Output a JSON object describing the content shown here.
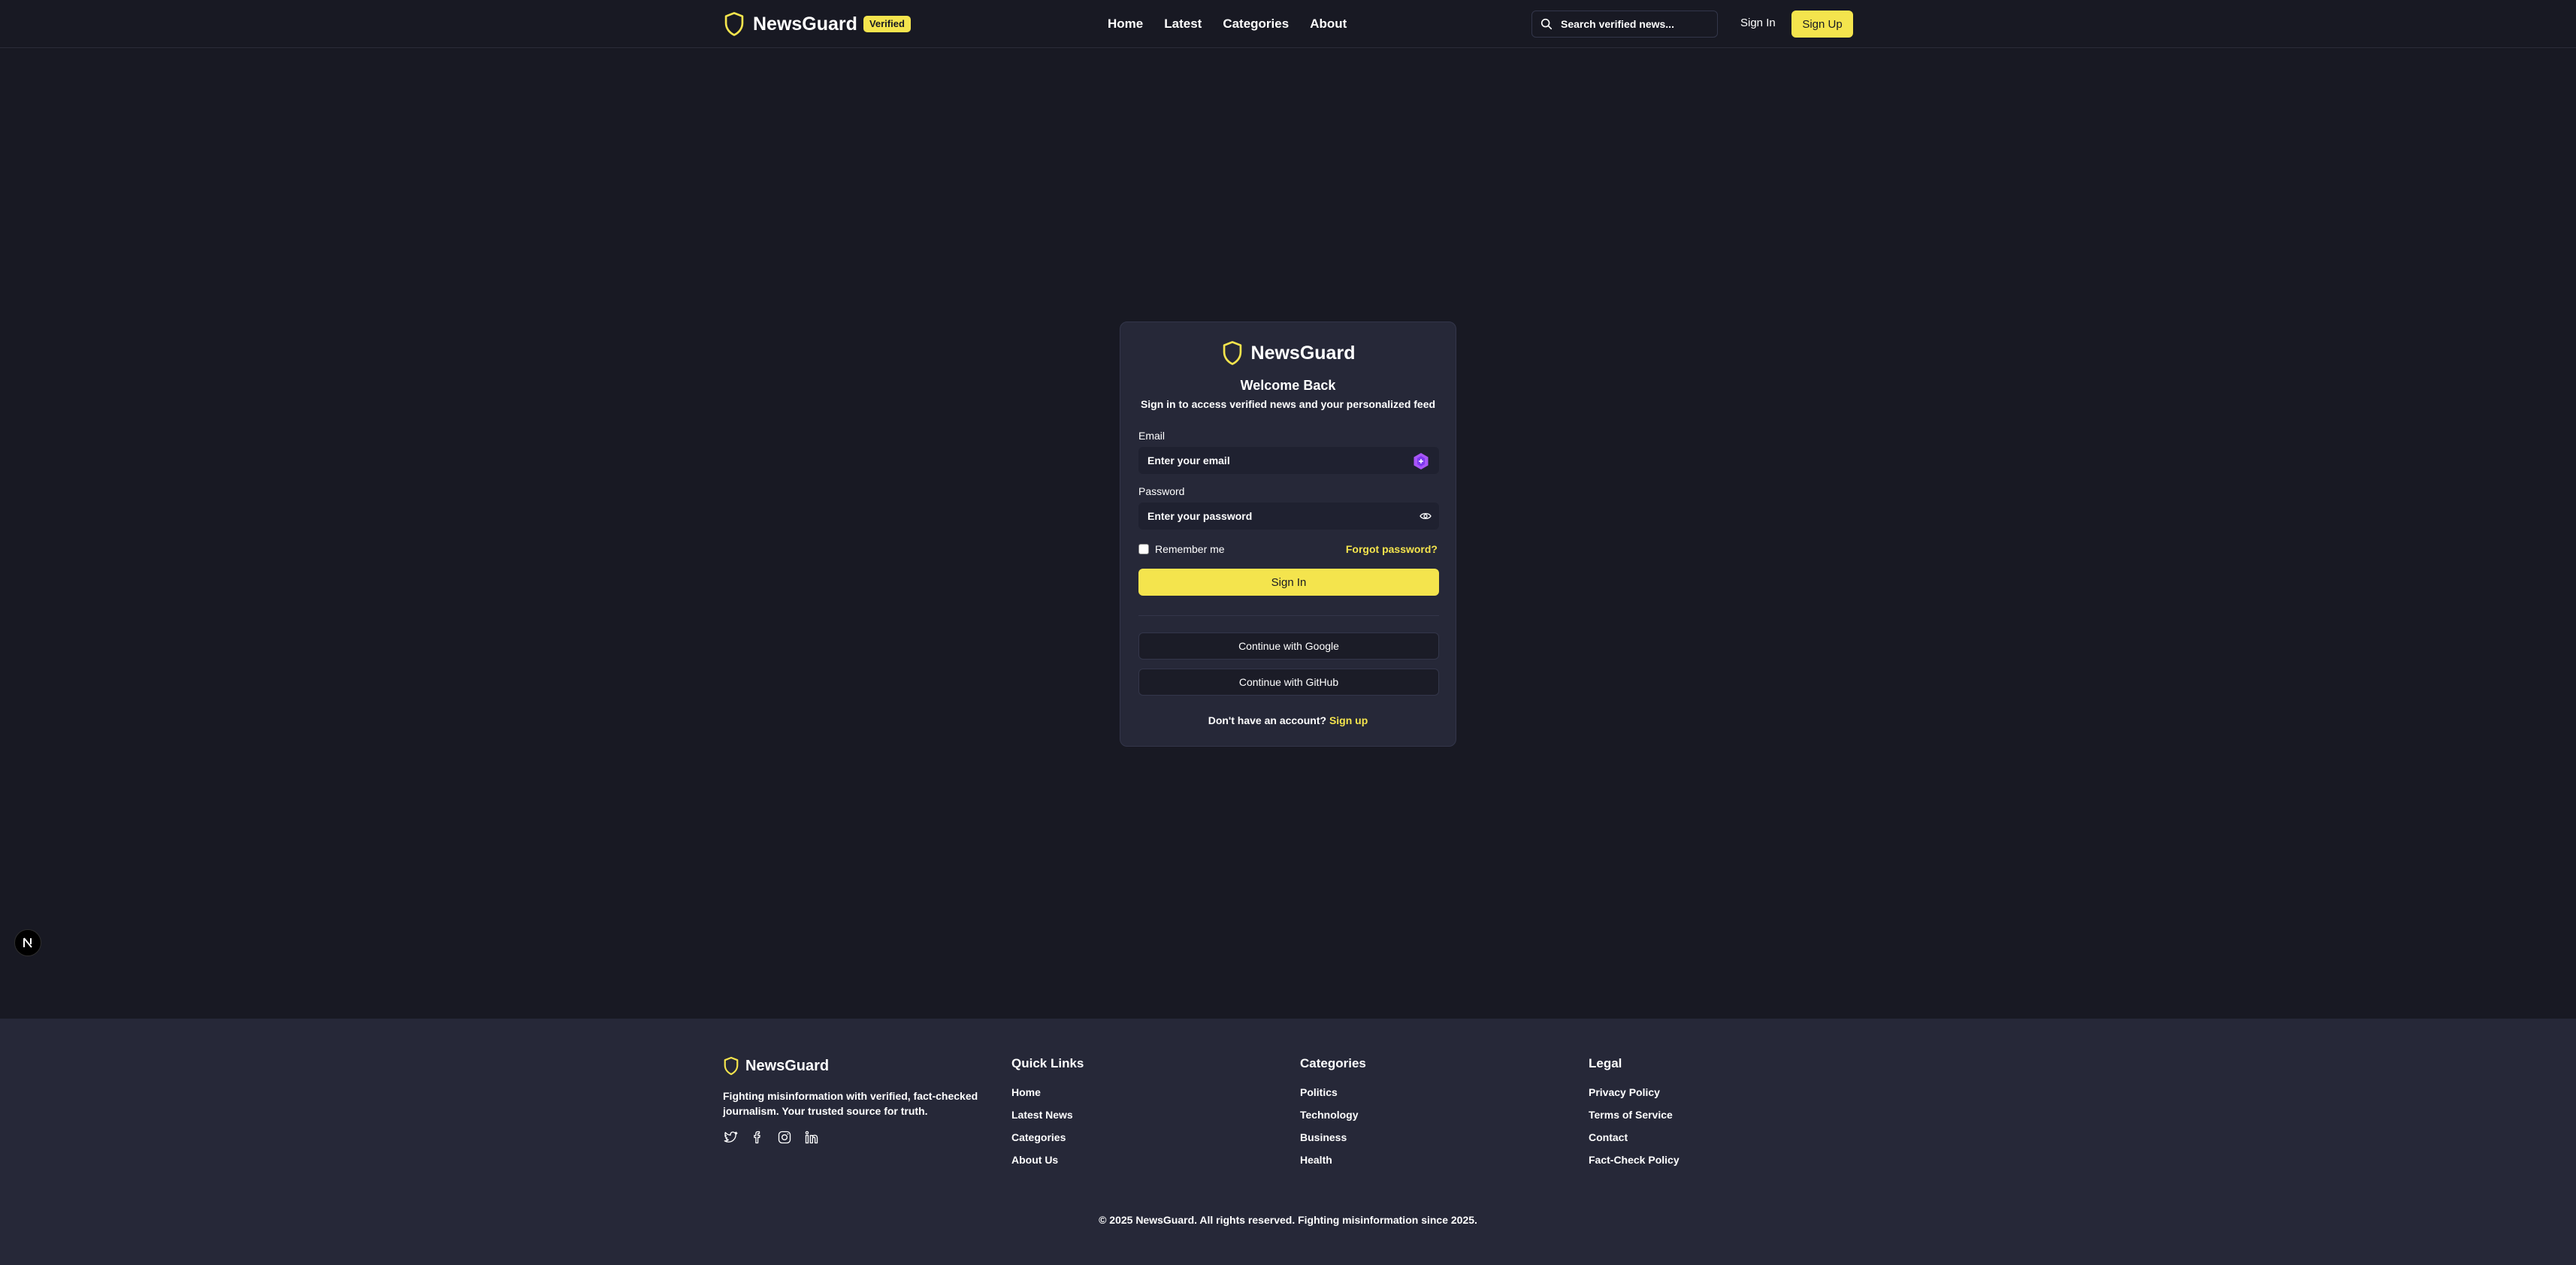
{
  "header": {
    "brand": "NewsGuard",
    "badge": "Verified",
    "nav": [
      "Home",
      "Latest",
      "Categories",
      "About"
    ],
    "search_placeholder": "Search verified news...",
    "signin": "Sign In",
    "signup": "Sign Up"
  },
  "login": {
    "brand": "NewsGuard",
    "title": "Welcome Back",
    "subtitle": "Sign in to access verified news and your personalized feed",
    "email_label": "Email",
    "email_placeholder": "Enter your email",
    "password_label": "Password",
    "password_placeholder": "Enter your password",
    "remember": "Remember me",
    "forgot": "Forgot password?",
    "submit": "Sign In",
    "google": "Continue with Google",
    "github": "Continue with GitHub",
    "no_account": "Don't have an account?",
    "signup_link": "Sign up"
  },
  "footer": {
    "brand": "NewsGuard",
    "tagline": "Fighting misinformation with verified, fact-checked journalism. Your trusted source for truth.",
    "columns": [
      {
        "title": "Quick Links",
        "links": [
          "Home",
          "Latest News",
          "Categories",
          "About Us"
        ]
      },
      {
        "title": "Categories",
        "links": [
          "Politics",
          "Technology",
          "Business",
          "Health"
        ]
      },
      {
        "title": "Legal",
        "links": [
          "Privacy Policy",
          "Terms of Service",
          "Contact",
          "Fact-Check Policy"
        ]
      }
    ],
    "copyright": "© 2025 NewsGuard. All rights reserved. Fighting misinformation since 2025."
  },
  "colors": {
    "background": "#181923",
    "card": "#262838",
    "accent": "#f4e44d"
  },
  "icons": [
    "shield-icon",
    "search-icon",
    "eye-icon",
    "twitter-icon",
    "facebook-icon",
    "instagram-icon",
    "linkedin-icon"
  ]
}
